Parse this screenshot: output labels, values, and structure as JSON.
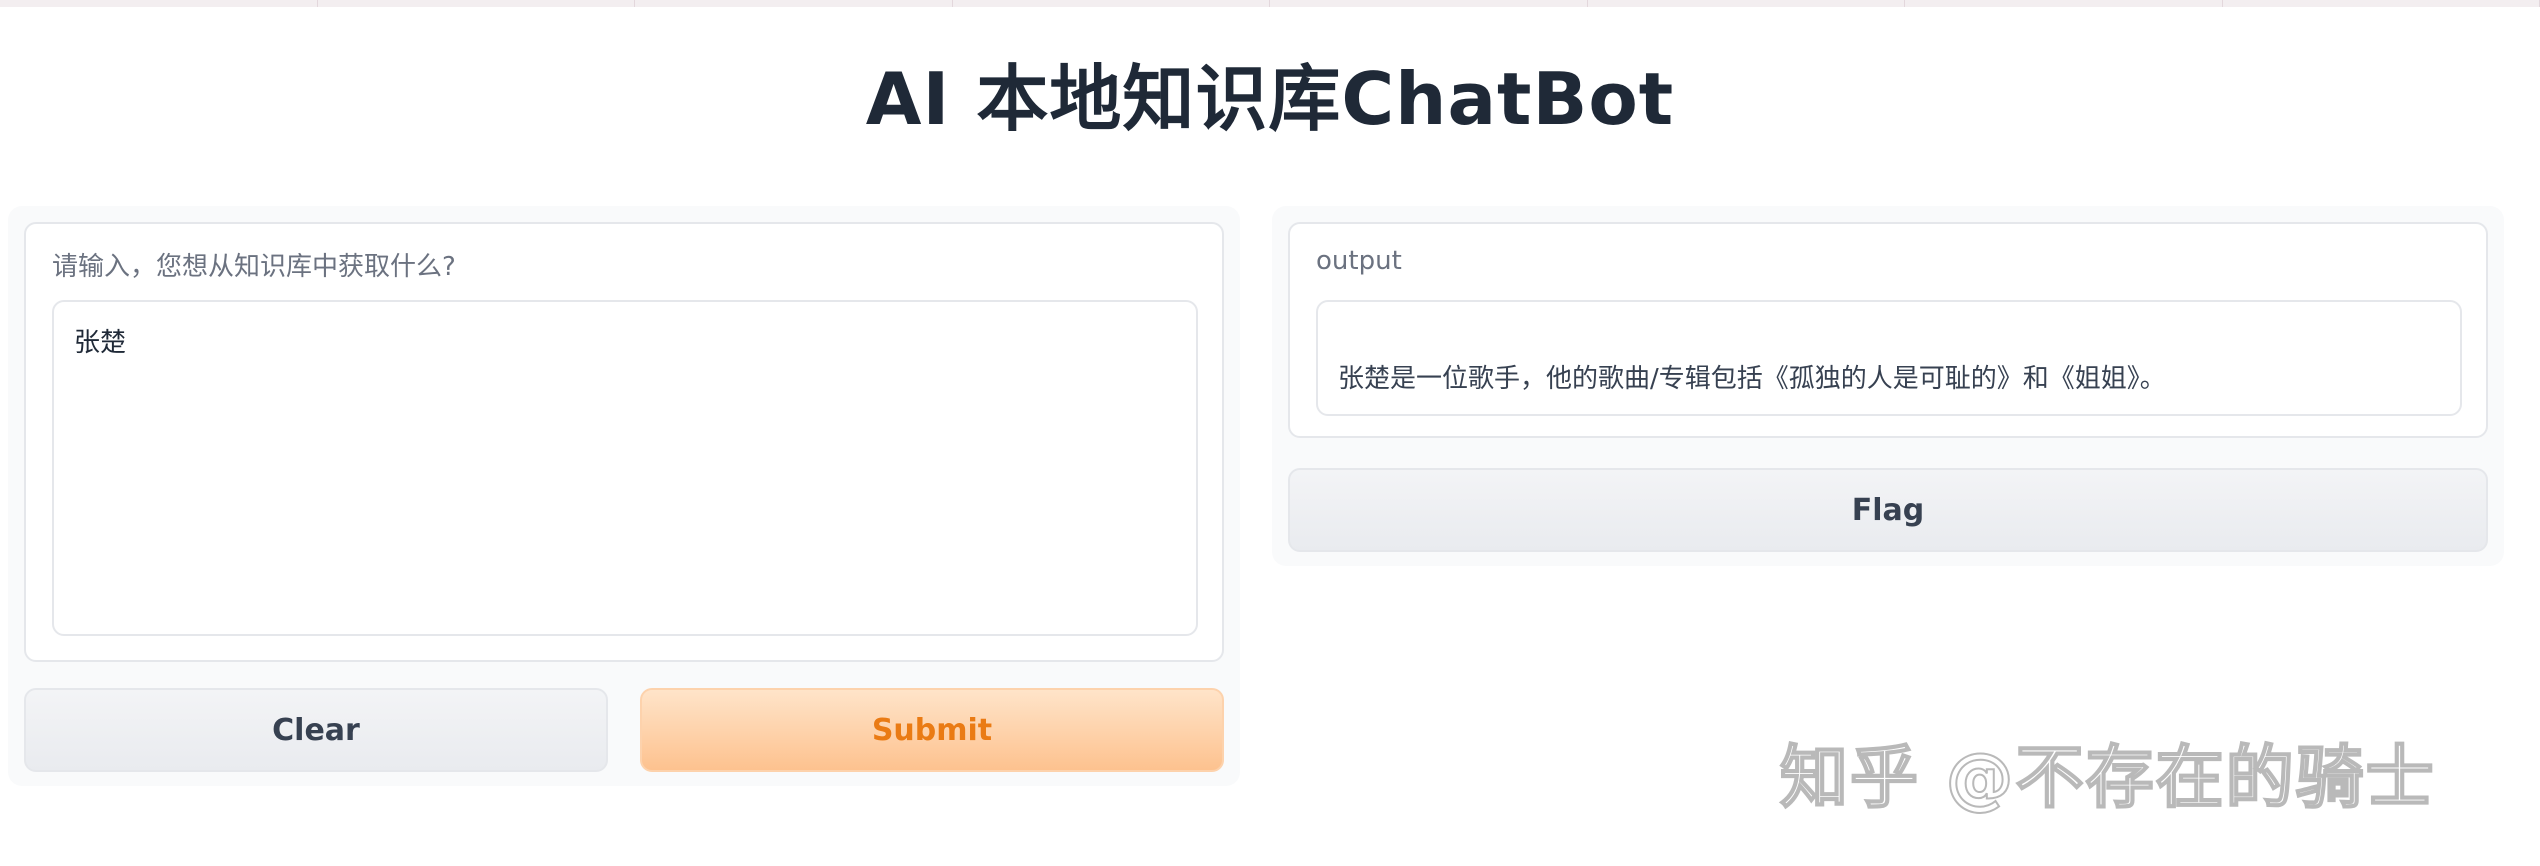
{
  "app": {
    "title": "AI 本地知识库ChatBot"
  },
  "input_panel": {
    "label": "请输入，您想从知识库中获取什么?",
    "value": "张楚",
    "clear_label": "Clear",
    "submit_label": "Submit"
  },
  "output_panel": {
    "label": "output",
    "value": "张楚是一位歌手，他的歌曲/专辑包括《孤独的人是可耻的》和《姐姐》。",
    "flag_label": "Flag"
  },
  "watermark": {
    "text": "知乎 @不存在的骑士"
  },
  "colors": {
    "submit_text": "#ea7b14",
    "submit_bg": "#fdc28f",
    "panel_bg": "#f9fafb",
    "border": "#e5e7eb"
  }
}
